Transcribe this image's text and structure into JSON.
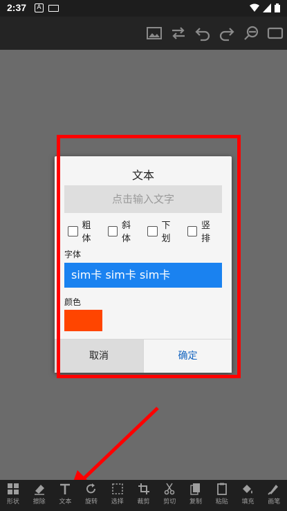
{
  "status_bar": {
    "time": "2:37",
    "notif_letter": "A"
  },
  "toolbar": {
    "icons": [
      "image-icon",
      "swap-icon",
      "undo-icon",
      "redo-icon",
      "zoom-out-icon",
      "fullscreen-icon"
    ]
  },
  "dialog": {
    "title": "文本",
    "input_placeholder": "点击输入文字",
    "options": [
      {
        "label": "粗体"
      },
      {
        "label": "斜体"
      },
      {
        "label": "下划"
      },
      {
        "label": "竖排"
      }
    ],
    "font_label": "字体",
    "font_sample": "sim卡 sim卡 sim卡",
    "color_label": "颜色",
    "color_value": "#ff4500",
    "cancel_label": "取消",
    "ok_label": "确定"
  },
  "bottom_bar": {
    "items": [
      {
        "label": "形状",
        "icon": "grid-icon"
      },
      {
        "label": "擦除",
        "icon": "eraser-icon"
      },
      {
        "label": "文本",
        "icon": "text-icon"
      },
      {
        "label": "旋转",
        "icon": "rotate-icon"
      },
      {
        "label": "选择",
        "icon": "select-icon"
      },
      {
        "label": "裁剪",
        "icon": "crop-icon"
      },
      {
        "label": "剪切",
        "icon": "cut-icon"
      },
      {
        "label": "复制",
        "icon": "copy-icon"
      },
      {
        "label": "粘贴",
        "icon": "paste-icon"
      },
      {
        "label": "填充",
        "icon": "fill-icon"
      },
      {
        "label": "画笔",
        "icon": "brush-icon"
      }
    ]
  },
  "colors": {
    "annotation_red": "#ff0000",
    "font_sample_bg": "#1a82f0",
    "ok_text": "#1565c0"
  }
}
